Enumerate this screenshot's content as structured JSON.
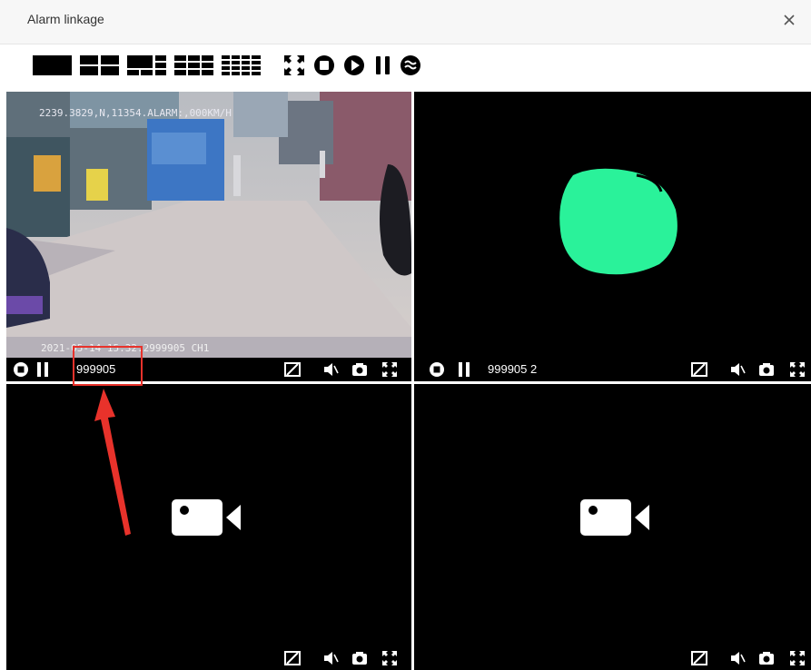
{
  "window": {
    "title": "Alarm linkage",
    "close_icon": "close-icon"
  },
  "toolbar": {
    "buttons": [
      {
        "name": "layout-1-button",
        "icon": "single-view-icon"
      },
      {
        "name": "layout-4-button",
        "icon": "quad-view-icon"
      },
      {
        "name": "layout-6-button",
        "icon": "six-view-icon"
      },
      {
        "name": "layout-9-button",
        "icon": "nine-view-icon"
      },
      {
        "name": "layout-16-button",
        "icon": "sixteen-view-icon"
      },
      {
        "name": "fullscreen-button",
        "icon": "fullscreen-icon"
      },
      {
        "name": "stop-all-button",
        "icon": "stop-icon"
      },
      {
        "name": "play-all-button",
        "icon": "play-icon"
      },
      {
        "name": "pause-all-button",
        "icon": "pause-icon"
      },
      {
        "name": "stream-switch-button",
        "icon": "stream-icon"
      }
    ]
  },
  "panes": [
    {
      "id": 1,
      "state": "playing",
      "label": "999905",
      "osd_top": "2239.3829,N,11354.ALARM:,000KM/H",
      "osd_bottom": "2021-05-14 15:32:2999905 CH1"
    },
    {
      "id": 2,
      "state": "playing",
      "label": "999905 2"
    },
    {
      "id": 3,
      "state": "idle",
      "label": ""
    },
    {
      "id": 4,
      "state": "idle",
      "label": ""
    }
  ],
  "colors": {
    "annotation": "#e8322b",
    "blob": "#2af29a"
  }
}
